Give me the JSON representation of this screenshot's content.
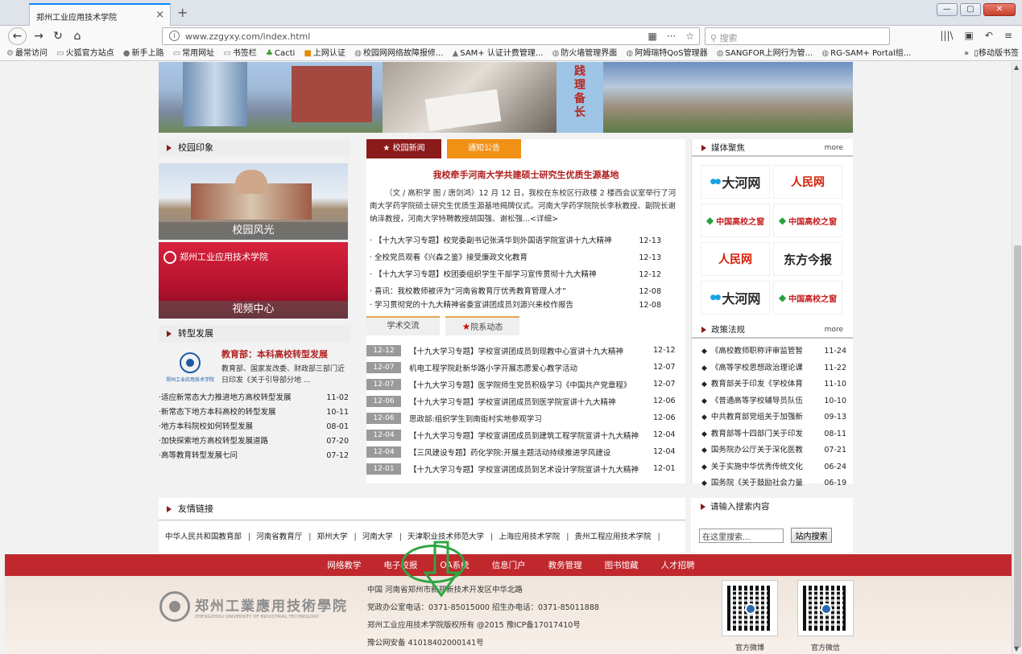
{
  "browser": {
    "tab_title": "郑州工业应用技术学院",
    "url": "www.zzgyxy.com/index.html",
    "search_placeholder": "搜索",
    "bookmarks": [
      "最常访问",
      "火狐官方站点",
      "新手上路",
      "常用网址",
      "书签栏",
      "Cacti",
      "上网认证",
      "校园网网络故障报修...",
      "SAM+ 认证计费管理...",
      "防火墙管理界面",
      "阿姆瑞特QoS管理器",
      "SANGFOR上网行为管...",
      "RG-SAM+ Portal组..."
    ],
    "mobile_bookmarks": "移动版书签"
  },
  "banner": {
    "vertical_text": "践理备长"
  },
  "campus_impression": {
    "title": "校园印象",
    "photo1_caption": "校园风光",
    "photo2_caption": "视频中心",
    "photo2_logo": "郑州工业应用技术学院"
  },
  "transformation": {
    "title": "转型发展",
    "feature_title": "教育部：本科高校转型发展",
    "feature_desc": "教育部、国家发改委、财政部三部门近日印发《关于引导部分地 ...",
    "logo_text": "郑州工业应用技术学院",
    "items": [
      {
        "t": "适应新常态大力推进地方高校转型发展",
        "d": "11-02"
      },
      {
        "t": "新常态下地方本科高校的转型发展",
        "d": "10-11"
      },
      {
        "t": "地方本科院校如何转型发展",
        "d": "08-01"
      },
      {
        "t": "加快探索地方高校转型发展道路",
        "d": "07-20"
      },
      {
        "t": "高等教育转型发展七问",
        "d": "07-12"
      }
    ]
  },
  "news": {
    "tab_news": "校园新闻",
    "tab_notice": "通知公告",
    "headline": "我校牵手河南大学共建硕士研究生优质生源基地",
    "summary": "（文 / 高积学 图 / 唐剑鸿）12 月 12 日，我校在东校区行政楼 2 楼西会议室举行了河南大学药学院硕士研究生优质生源基地揭牌仪式。河南大学药学院院长李秋教授、副院长谢纳泽教授，河南大学特聘教授胡国强、谢松强...<详细>",
    "items": [
      {
        "t": "· 【十九大学习专题】校党委副书记张清华到外国语学院宣讲十九大精神",
        "d": "12-13"
      },
      {
        "t": "· 全校党员观看《兴森之鉴》接受廉政文化教育",
        "d": "12-13"
      },
      {
        "t": "· 【十九大学习专题】校团委组织学生干部学习宣传贯彻十九大精神",
        "d": "12-12"
      },
      {
        "t": "· 喜讯：我校教师被评为“河南省教育厅优秀教育管理人才”",
        "d": "12-08"
      },
      {
        "t": "· 学习贯彻党的十九大精神省委宣讲团成员刘源兴来校作报告",
        "d": "12-08"
      }
    ]
  },
  "academic": {
    "tab_academic": "学术交流",
    "tab_dept": "院系动态",
    "items": [
      {
        "d": "12-12",
        "t": "【十九大学习专题】学校宣讲团成员到现教中心宣讲十九大精神",
        "r": "12-12"
      },
      {
        "d": "12-07",
        "t": "机电工程学院赴新华路小学开展志愿爱心教学活动",
        "r": "12-07"
      },
      {
        "d": "12-07",
        "t": "【十九大学习专题】医学院师生党员积极学习《中国共产党章程》",
        "r": "12-07"
      },
      {
        "d": "12-06",
        "t": "【十九大学习专题】学校宣讲团成员到医学院宣讲十九大精神",
        "r": "12-06"
      },
      {
        "d": "12-06",
        "t": "思政部:组织学生到南街村实地参观学习",
        "r": "12-06"
      },
      {
        "d": "12-04",
        "t": "【十九大学习专题】学校宣讲团成员到建筑工程学院宣讲十九大精神",
        "r": "12-04"
      },
      {
        "d": "12-04",
        "t": "【三风建设专题】药化学院:开展主题活动持续推进学风建设",
        "r": "12-04"
      },
      {
        "d": "12-01",
        "t": "【十九大学习专题】学校宣讲团成员到艺术设计学院宣讲十九大精神",
        "r": "12-01"
      }
    ]
  },
  "media": {
    "title": "媒体聚焦",
    "more": "more",
    "logos": [
      "大河网",
      "人民网",
      "中国高校之窗",
      "中国高校之窗",
      "人民网",
      "东方今报",
      "大河网",
      "中国高校之窗"
    ]
  },
  "policy": {
    "title": "政策法规",
    "more": "more",
    "items": [
      {
        "t": "《高校教师职称评审监管暂",
        "d": "11-24"
      },
      {
        "t": "《高等学校思想政治理论课",
        "d": "11-22"
      },
      {
        "t": "教育部关于印发《学校体育",
        "d": "11-10"
      },
      {
        "t": "《普通高等学校辅导员队伍",
        "d": "10-10"
      },
      {
        "t": "中共教育部党组关于加强新",
        "d": "09-13"
      },
      {
        "t": "教育部等十四部门关于印发",
        "d": "08-11"
      },
      {
        "t": "国务院办公厅关于深化医教",
        "d": "07-21"
      },
      {
        "t": "关于实施中华优秀传统文化",
        "d": "06-24"
      },
      {
        "t": "国务院《关于鼓励社会力量",
        "d": "06-19"
      }
    ]
  },
  "friend_links": {
    "title": "友情链接",
    "items": [
      "中华人民共和国教育部",
      "河南省教育厅",
      "郑州大学",
      "河南大学",
      "天津职业技术师范大学",
      "上海应用技术学院",
      "贵州工程应用技术学院"
    ]
  },
  "search": {
    "title": "请输入搜索内容",
    "value": "在这里搜索...",
    "button": "站内搜索"
  },
  "footer_nav": [
    "网络教学",
    "电子校报",
    "OA系统",
    "信息门户",
    "教务管理",
    "图书馆藏",
    "人才招聘"
  ],
  "footer": {
    "logo_cn": "郑州工業應用技術學院",
    "logo_en": "ZHENGZHOU UNIVERSITY OF INDUSTRIAL TECHNOLOGY",
    "lines": [
      "中国  河南省郑州市新郑新技术开发区中华北路",
      "党政办公室电话：0371-85015000  招生办电话：0371-85011888",
      "郑州工业应用技术学院版权所有 @2015 豫ICP备17017410号",
      "豫公网安备 41018402000141号"
    ],
    "qr_weibo": "官方微博",
    "qr_weixin": "官方微信"
  },
  "colors": {
    "brand_red": "#c0282d",
    "tab_red": "#8b1a1a",
    "tab_orange": "#f09015",
    "annotation_green": "#2fa542"
  }
}
